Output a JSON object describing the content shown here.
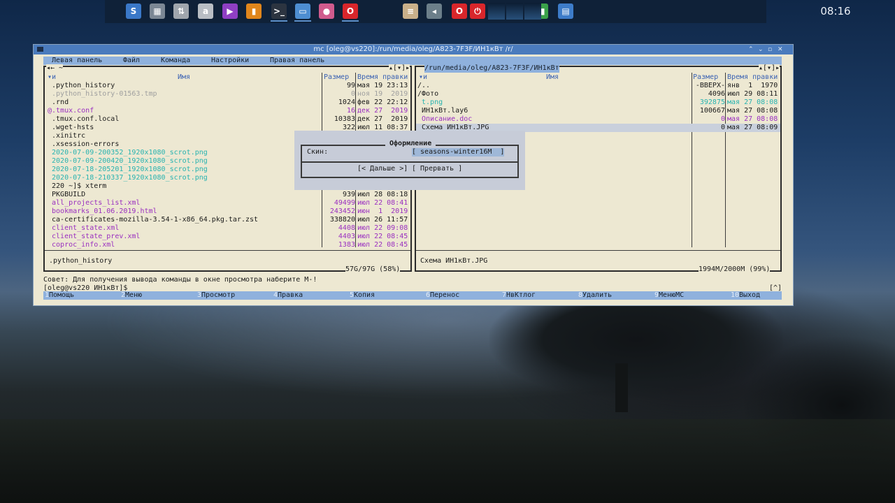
{
  "clock": "08:16",
  "taskbar_icons": [
    {
      "name": "skype-icon",
      "color": "#3a78c8"
    },
    {
      "name": "calculator-icon",
      "color": "#7b8794"
    },
    {
      "name": "transfer-icon",
      "color": "#a0a6ad"
    },
    {
      "name": "a-circle-icon",
      "color": "#b9bec4"
    },
    {
      "name": "media-player-icon",
      "color": "#8f3fc4"
    },
    {
      "name": "equalizer-icon",
      "color": "#e0861c"
    },
    {
      "name": "terminal-icon",
      "color": "#2c3440"
    },
    {
      "name": "window-icon",
      "color": "#4d8ed2"
    },
    {
      "name": "palette-icon",
      "color": "#d05b8d"
    },
    {
      "name": "opera-icon",
      "color": "#d9262b"
    },
    {
      "name": "notes-icon",
      "color": "#c9b08a"
    },
    {
      "name": "speaker-icon",
      "color": "#6c7f8a"
    },
    {
      "name": "opera-icon",
      "color": "#d9262b"
    },
    {
      "name": "power-icon",
      "color": "#d9262b"
    },
    {
      "name": "system-monitor-icon",
      "color": "#3aa24a"
    },
    {
      "name": "switcher-icon",
      "color": "#3d7cc9"
    }
  ],
  "window": {
    "title": "mc [oleg@vs220]:/run/media/oleg/A823-7F3F/ИН1кВт  /r/",
    "controls": [
      "⌃",
      "⌄",
      "▫",
      "✕"
    ]
  },
  "menubar": [
    "Левая панель",
    "Файл",
    "Команда",
    "Настройки",
    "Правая панель"
  ],
  "left_panel": {
    "top_left": "◂← ~",
    "top_right": "▴[▾]▸",
    "col_sort": "▾и",
    "col_name": "Имя",
    "col_size": "Размер",
    "col_time": "Время правки",
    "rows": [
      {
        "name": " .python_history",
        "size": "99",
        "time": "мая 19 23:13",
        "cls": "c-norm"
      },
      {
        "name": " .python_history-01563.tmp",
        "size": "0",
        "time": "ноя 19  2019",
        "cls": "c-dim"
      },
      {
        "name": " .rnd",
        "size": "1024",
        "time": "фев 22 22:12",
        "cls": "c-norm"
      },
      {
        "name": "@.tmux.conf",
        "size": "16",
        "time": "дек 27  2019",
        "cls": "c-link"
      },
      {
        "name": " .tmux.conf.local",
        "size": "10383",
        "time": "дек 27  2019",
        "cls": "c-norm"
      },
      {
        "name": " .wget-hsts",
        "size": "322",
        "time": "июл 11 08:37",
        "cls": "c-norm"
      },
      {
        "name": " .xinitrc",
        "size": "",
        "time": "",
        "cls": "c-norm"
      },
      {
        "name": " .xsession-errors",
        "size": "",
        "time": "",
        "cls": "c-norm"
      },
      {
        "name": " 2020-07-09-200352_1920x1080_scrot.png",
        "size": "",
        "time": "",
        "cls": "c-img"
      },
      {
        "name": " 2020-07-09-200420_1920x1080_scrot.png",
        "size": "",
        "time": "",
        "cls": "c-img"
      },
      {
        "name": " 2020-07-18-205201_1920x1080_scrot.png",
        "size": "",
        "time": "",
        "cls": "c-img"
      },
      {
        "name": " 2020-07-18-210337_1920x1080_scrot.png",
        "size": "",
        "time": "",
        "cls": "c-img"
      },
      {
        "name": " 220 ~]$ xterm",
        "size": "",
        "time": "",
        "cls": "c-norm"
      },
      {
        "name": " PKGBUILD",
        "size": "939",
        "time": "июл 28 08:18",
        "cls": "c-norm"
      },
      {
        "name": " all_projects_list.xml",
        "size": "49499",
        "time": "июл 22 08:41",
        "cls": "c-doc"
      },
      {
        "name": " bookmarks_01.06.2019.html",
        "size": "243452",
        "time": "июн  1  2019",
        "cls": "c-doc"
      },
      {
        "name": " ca-certificates-mozilla-3.54-1-x86_64.pkg.tar.zst",
        "size": "338820",
        "time": "июл 26 11:57",
        "cls": "c-norm"
      },
      {
        "name": " client_state.xml",
        "size": "4408",
        "time": "июл 22 09:08",
        "cls": "c-doc"
      },
      {
        "name": " client_state_prev.xml",
        "size": "4403",
        "time": "июл 22 08:45",
        "cls": "c-doc"
      },
      {
        "name": " coproc_info.xml",
        "size": "1383",
        "time": "июл 22 08:45",
        "cls": "c-doc"
      }
    ],
    "mini_status": ".python_history",
    "free_space": "57G/97G (58%)"
  },
  "right_panel": {
    "path": " /run/media/oleg/A823-7F3F/ИН1кВт ",
    "top_right": "▴[▾]▸",
    "col_sort": "▾и",
    "col_name": "Имя",
    "col_size": "Размер",
    "col_time": "Время правки",
    "rows": [
      {
        "name": "/..",
        "size": "-ВВЕРХ-",
        "time": "янв  1  1970",
        "cls": "c-norm"
      },
      {
        "name": "/Фото",
        "size": "4096",
        "time": "июл 29 08:11",
        "cls": "c-norm"
      },
      {
        "name": " t.png",
        "size": "392875",
        "time": "мая 27 08:08",
        "cls": "c-img"
      },
      {
        "name": " ИН1кВт.lay6",
        "size": "100667",
        "time": "мая 27 08:08",
        "cls": "c-norm"
      },
      {
        "name": " Описание.doc",
        "size": "0",
        "time": "мая 27 08:08",
        "cls": "c-doc"
      },
      {
        "name": " Схема ИН1кВт.JPG",
        "size": "0",
        "time": "мая 27 08:09",
        "cls": "c-norm"
      }
    ],
    "mini_status": "Схема ИН1кВт.JPG",
    "free_space": "1994M/2000M (99%)"
  },
  "dialog": {
    "title": " Оформление ",
    "label": "Скин:",
    "value": "[ seasons-winter16M  ]",
    "btn_next": "[< Дальше >]",
    "btn_abort": "[ Прервать ]"
  },
  "hint": "Совет: Для получения вывода команды в окне просмотра наберите M-!",
  "prompt": "[oleg@vs220 ИН1кВт]$",
  "prompt_right": "[^]",
  "fkeys": [
    {
      "n": "1",
      "label": "Помощь"
    },
    {
      "n": "2",
      "label": "Меню"
    },
    {
      "n": "3",
      "label": "Просмотр"
    },
    {
      "n": "4",
      "label": "Правка"
    },
    {
      "n": "5",
      "label": "Копия"
    },
    {
      "n": "6",
      "label": "Перенос"
    },
    {
      "n": "7",
      "label": "НвКтлог"
    },
    {
      "n": "8",
      "label": "Удалить"
    },
    {
      "n": "9",
      "label": "МенюMC"
    },
    {
      "n": "10",
      "label": "Выход"
    }
  ]
}
